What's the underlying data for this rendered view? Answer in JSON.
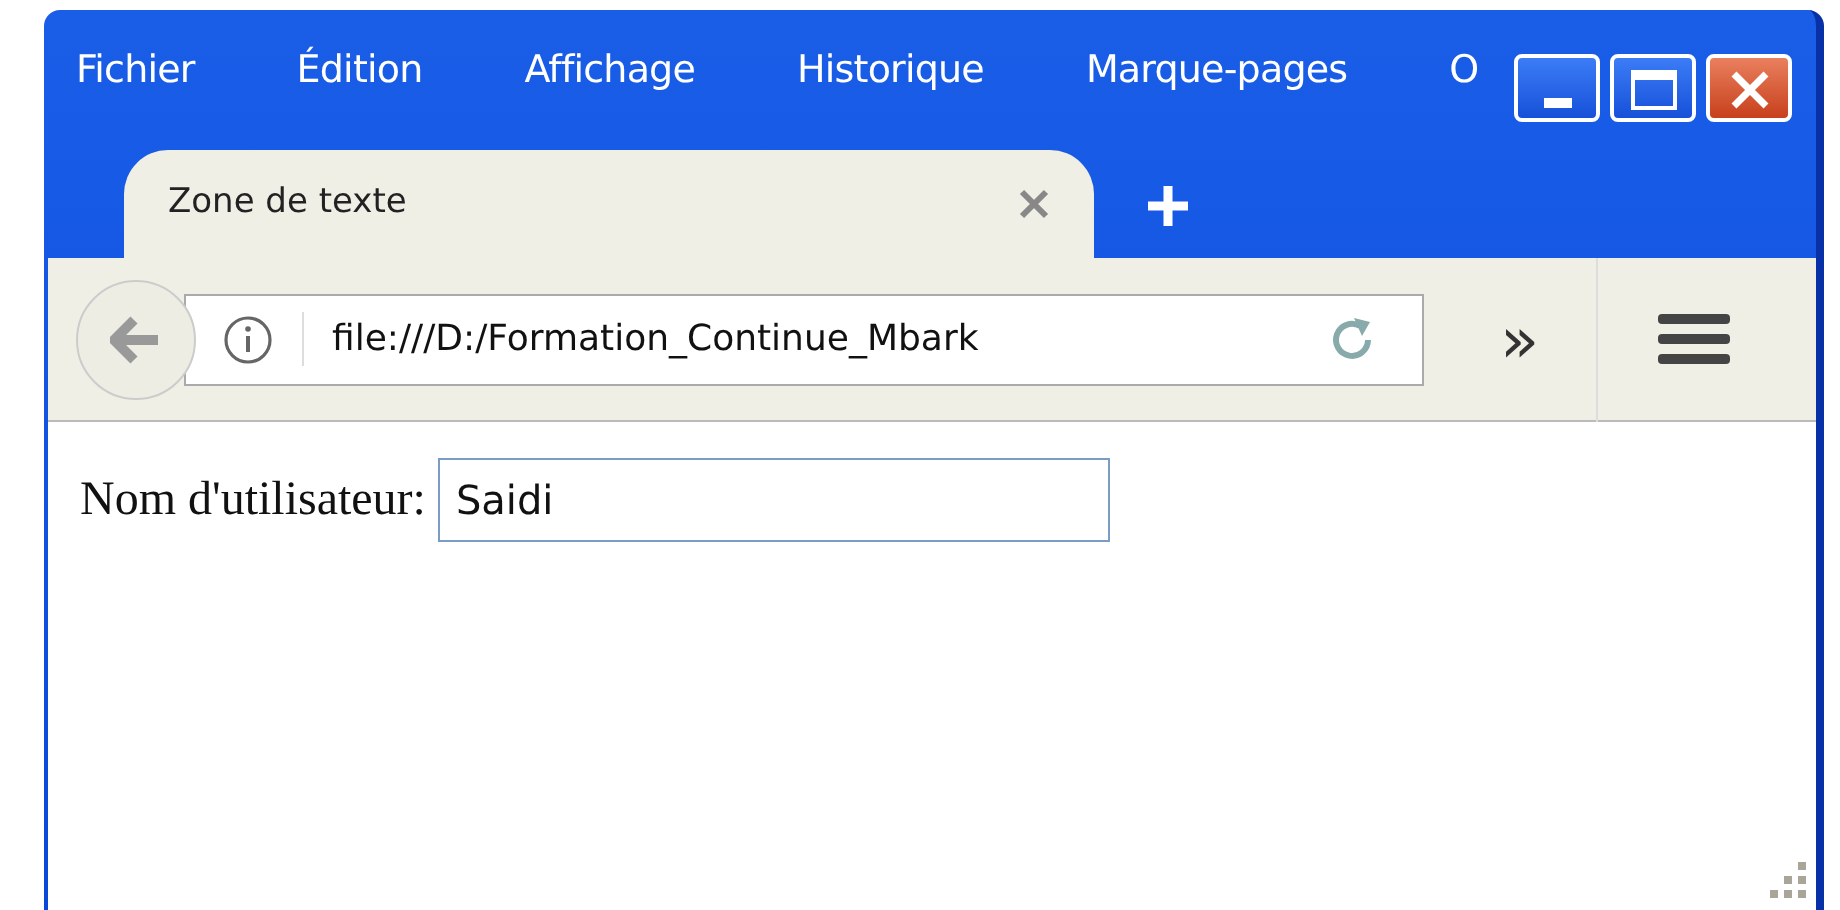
{
  "menu": [
    "Fichier",
    "Édition",
    "Affichage",
    "Historique",
    "Marque-pages",
    "O"
  ],
  "tabs": [
    {
      "label": "Zone de texte",
      "selected": true
    }
  ],
  "address": {
    "url": "file:///D:/Formation_Continue_Mbark"
  },
  "toolbar": {
    "overflow": "»"
  },
  "form": {
    "label": "Nom d'utilisateur:",
    "value": "Saidi"
  }
}
